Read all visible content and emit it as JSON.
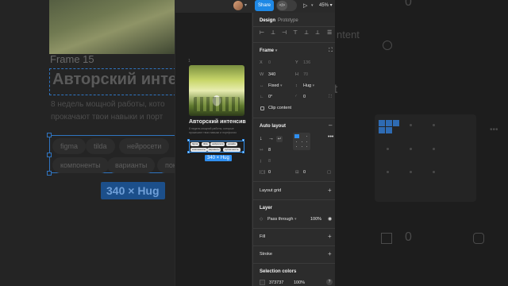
{
  "background": {
    "frame_label": "Frame 15",
    "title": "Авторский интенс",
    "desc_lines": [
      "8 недель мощной работы, кото",
      "прокачают твои навыки и порт"
    ],
    "tags": [
      "figma",
      "tilda",
      "нейросети",
      "компоненты",
      "варианты",
      "пок"
    ],
    "size_badge": "340 × Hug",
    "right_texts": {
      "top_num": "0",
      "heading": "ntent",
      "num_mid": "t",
      "num_bottom": "0",
      "ellipsis": "•••"
    }
  },
  "canvas": {
    "frame_number": "1",
    "title": "Авторский интенсив",
    "desc_lines": [
      "8 недель мощной работы, которые",
      "прокачают твои навыки и портфолио"
    ],
    "tags": [
      "figma",
      "tilda",
      "нейросети",
      "дизайн",
      "компоненты",
      "варианты",
      "публичность"
    ],
    "size_badge": "340 × Hug"
  },
  "topbar": {
    "share": "Share",
    "dev_mode": "</>",
    "zoom": "45%"
  },
  "panel": {
    "tabs": [
      "Design",
      "Prototype"
    ],
    "frame": {
      "title": "Frame",
      "x_label": "X",
      "x_value": "0",
      "y_label": "Y",
      "y_value": "136",
      "w_label": "W",
      "w_value": "340",
      "h_label": "H",
      "h_value": "70",
      "width_mode": "Fixed",
      "height_mode": "Hug",
      "rotation": "0°",
      "radius": "0",
      "clip_content": "Clip content"
    },
    "auto_layout": {
      "title": "Auto layout",
      "gap": "8",
      "gap_v": "8",
      "padding_h": "0",
      "padding_v": "0"
    },
    "layout_grid": {
      "title": "Layout grid"
    },
    "layer": {
      "title": "Layer",
      "blend": "Pass through",
      "opacity": "100%"
    },
    "fill": {
      "title": "Fill"
    },
    "stroke": {
      "title": "Stroke"
    },
    "selection_colors": {
      "title": "Selection colors",
      "hex": "373737",
      "opacity": "100%"
    }
  },
  "colors": {
    "accent": "#2f8ff0",
    "panel_bg": "#2c2c2c",
    "share_btn": "#1e88e5"
  }
}
